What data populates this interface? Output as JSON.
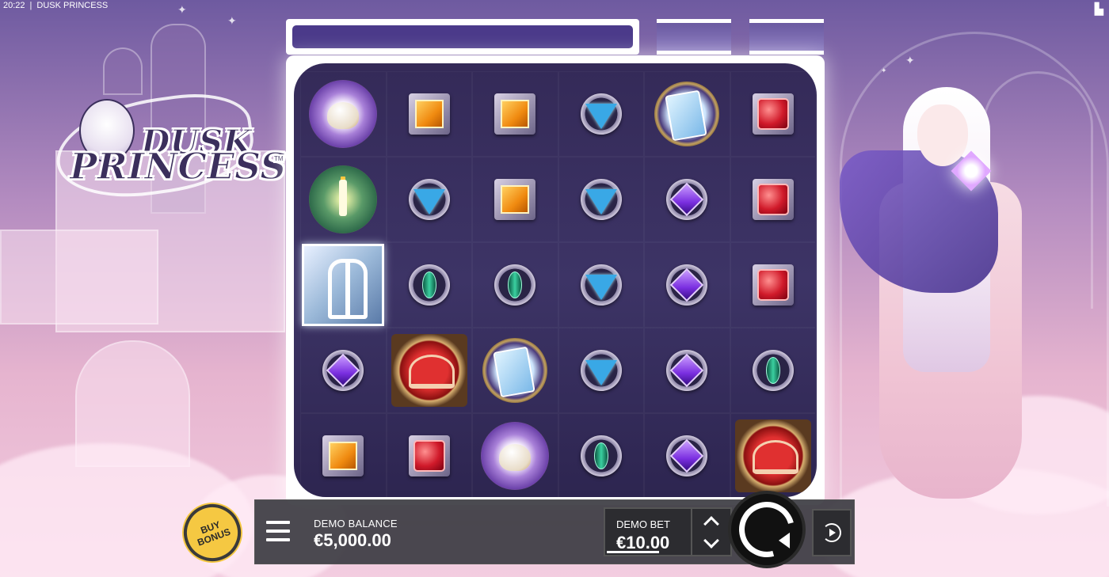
{
  "status_bar": {
    "time": "20:22",
    "separator": "|",
    "game_title": "DUSK PRINCESS"
  },
  "logo": {
    "line1": "DUSK",
    "line2": "PRINCESS",
    "tm": "TM"
  },
  "grid": {
    "columns": 6,
    "rows": 5,
    "symbols": [
      [
        "teapot",
        "orange-gem",
        "orange-gem",
        "blue-gem",
        "cards",
        "red-gem"
      ],
      [
        "candle",
        "blue-gem",
        "orange-gem",
        "blue-gem",
        "purple-gem",
        "red-gem"
      ],
      [
        "scatter",
        "green-gem",
        "green-gem",
        "blue-gem",
        "purple-gem",
        "red-gem"
      ],
      [
        "purple-gem",
        "crown",
        "cards",
        "blue-gem",
        "purple-gem",
        "green-gem"
      ],
      [
        "orange-gem",
        "red-gem",
        "teapot",
        "green-gem",
        "purple-gem",
        "crown"
      ]
    ]
  },
  "controls": {
    "buy_bonus_line1": "BUY",
    "buy_bonus_line2": "BONUS",
    "balance_label": "DEMO BALANCE",
    "balance_value": "€5,000.00",
    "bet_label": "DEMO BET",
    "bet_value": "€10.00"
  },
  "icons": {
    "menu": "hamburger-menu-icon",
    "spin": "spin-icon",
    "autoplay": "autoplay-icon",
    "bet_up": "chevron-up-icon",
    "bet_down": "chevron-down-icon"
  },
  "colors": {
    "buy_bonus": "#f5c842",
    "control_bar": "#3c3c42",
    "reel_bg": "#342a58"
  }
}
